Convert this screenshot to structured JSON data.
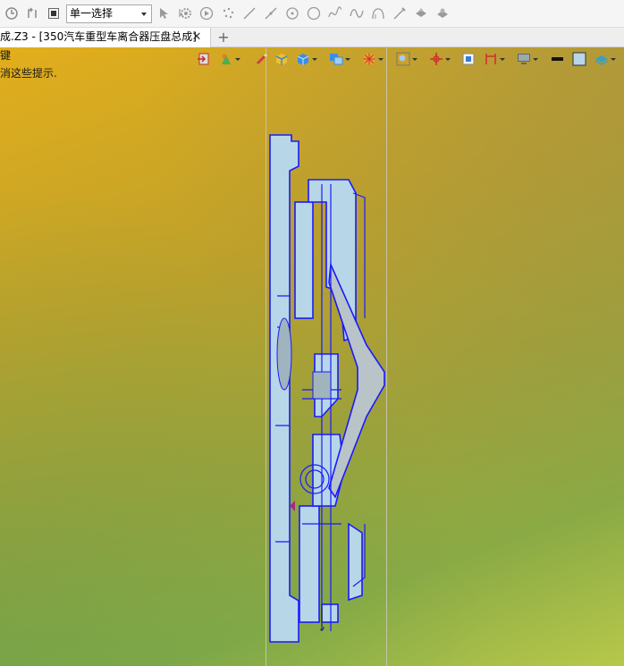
{
  "toolbar": {
    "select_value": "单一选择",
    "icons": [
      "undo-icon",
      "redo-icon",
      "stop-icon",
      "pick-arrow-icon",
      "pick-settings-icon",
      "play-icon",
      "points-icon",
      "line-icon",
      "line-point-icon",
      "circle-point-icon",
      "circle-icon",
      "curve-icon",
      "spline-icon",
      "arc-icon",
      "pen-icon",
      "shape-icon",
      "shape-settings-icon"
    ]
  },
  "tab": {
    "label": "成.Z3 - [350汽车重型车离合器压盘总成]",
    "close_glyph": "✕",
    "add_glyph": "+"
  },
  "viewport": {
    "hint_line1": "键",
    "hint_line2": "消这些提示.",
    "colors": {
      "background_top": "#e2ae1c",
      "background_bottom": "#b7c84a",
      "part_fill": "#b7d7e8",
      "part_edge": "#1a1aff"
    }
  }
}
